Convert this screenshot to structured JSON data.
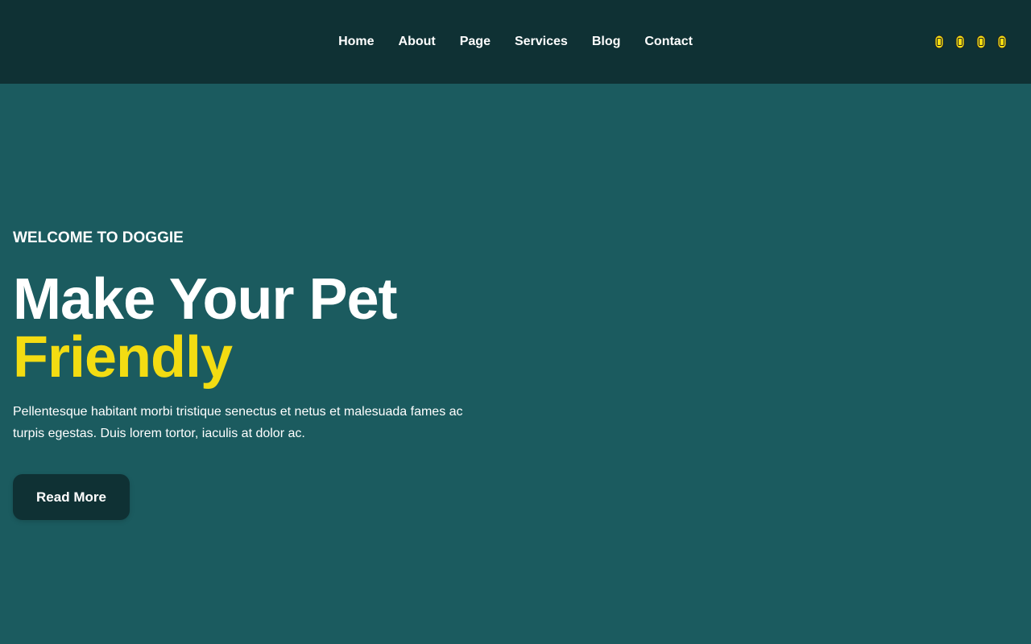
{
  "nav": {
    "items": [
      {
        "label": "Home"
      },
      {
        "label": "About"
      },
      {
        "label": "Page"
      },
      {
        "label": "Services"
      },
      {
        "label": "Blog"
      },
      {
        "label": "Contact"
      }
    ]
  },
  "social_icons": [
    {
      "name": "social-icon-1",
      "color": "#f3dc12"
    },
    {
      "name": "social-icon-2",
      "color": "#f3dc12"
    },
    {
      "name": "social-icon-3",
      "color": "#f3dc12"
    },
    {
      "name": "social-icon-4",
      "color": "#f3dc12"
    }
  ],
  "hero": {
    "eyebrow": "WELCOME TO DOGGIE",
    "headline_line1": "Make Your Pet",
    "headline_line2": "Friendly",
    "description": "Pellentesque habitant morbi tristique senectus et netus et malesuada fames ac turpis egestas. Duis lorem tortor, iaculis at dolor ac.",
    "button_label": "Read More"
  },
  "colors": {
    "header_bg": "#0f3134",
    "page_bg": "#1b5b5f",
    "accent": "#f3dc12"
  }
}
